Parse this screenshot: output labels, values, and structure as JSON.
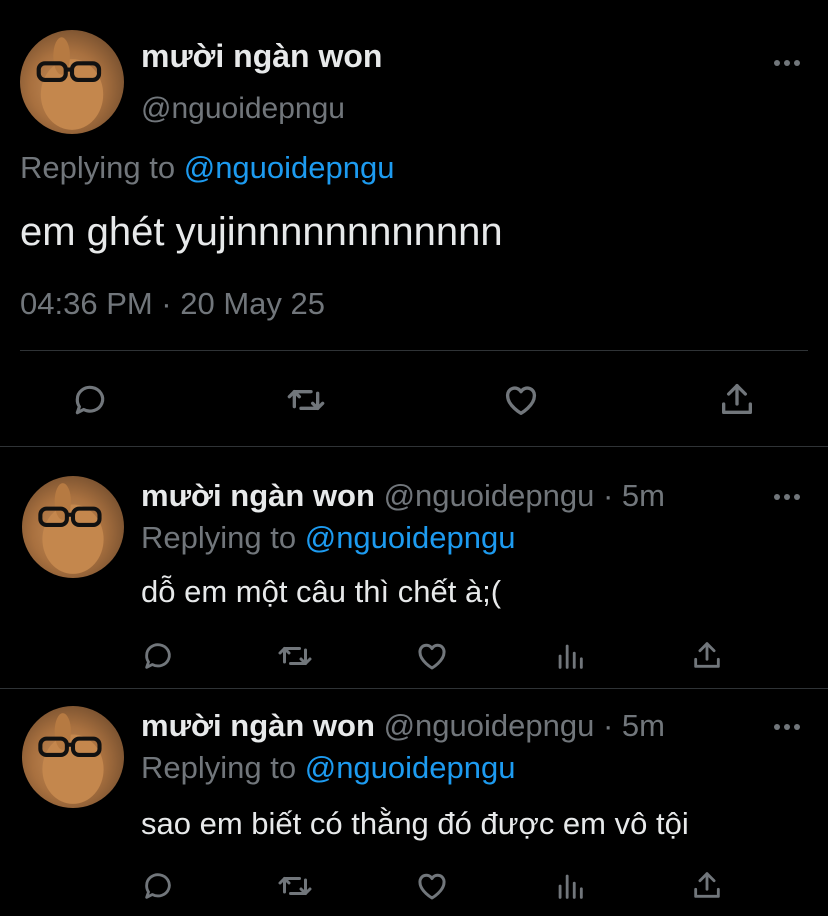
{
  "main_tweet": {
    "display_name": "mười ngàn won",
    "handle": "@nguoidepngu",
    "replying_prefix": "Replying to",
    "replying_to": "@nguoidepngu",
    "text": "em ghét yujinnnnnnnnnnnn",
    "timestamp": "04:36 PM · 20 May 25"
  },
  "replies": [
    {
      "display_name": "mười ngàn won",
      "handle": "@nguoidepngu",
      "time": "· 5m",
      "replying_prefix": "Replying to",
      "replying_to": "@nguoidepngu",
      "text": "dỗ em một câu thì chết à;("
    },
    {
      "display_name": "mười ngàn won",
      "handle": "@nguoidepngu",
      "time": "· 5m",
      "replying_prefix": "Replying to",
      "replying_to": "@nguoidepngu",
      "text": "sao em biết có thằng đó được em vô tội"
    }
  ],
  "icons": [
    "reply-icon",
    "retweet-icon",
    "like-icon",
    "share-icon",
    "analytics-icon",
    "more-icon"
  ],
  "colors": {
    "background": "#000000",
    "text": "#e7e9ea",
    "secondary": "#71767b",
    "link": "#1d9bf0",
    "divider": "#2f3336"
  }
}
